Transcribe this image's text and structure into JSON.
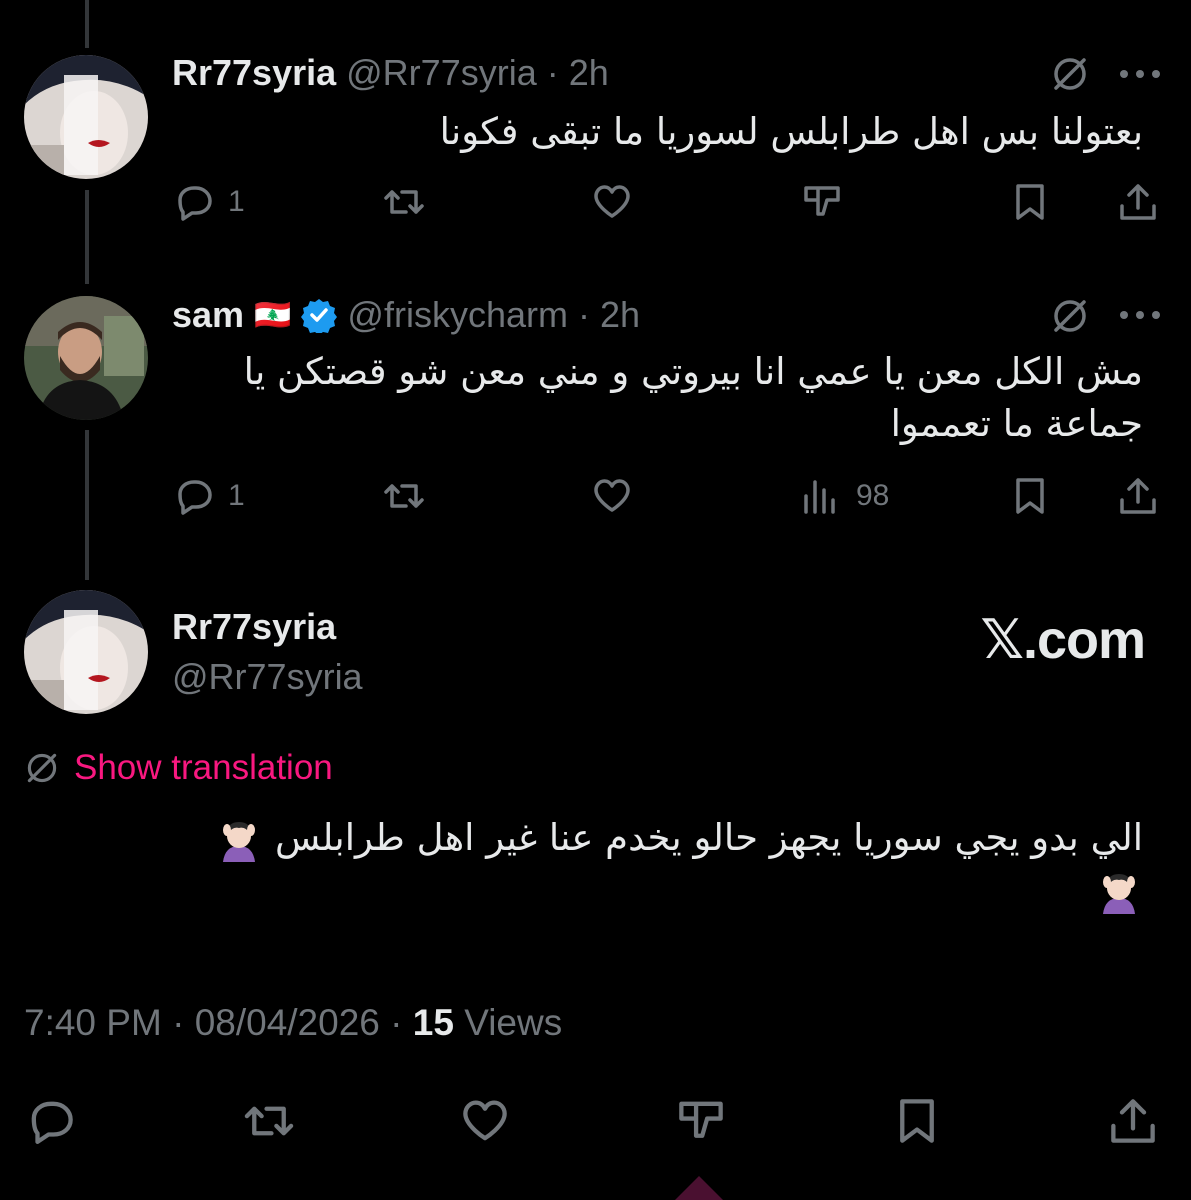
{
  "brand_label": "𝕏.com",
  "accent_color": "#f91880",
  "verified_color": "#1d9bf0",
  "tweets": [
    {
      "display_name": "Rr77syria",
      "handle": "@Rr77syria",
      "time": "2h",
      "text": "بعتولنا بس اهل طرابلس لسوريا ما تبقى فكونا",
      "reply_count": "1",
      "icons": [
        "reply-icon",
        "retweet-icon",
        "like-icon",
        "dislike-icon",
        "bookmark-icon",
        "share-icon"
      ]
    },
    {
      "display_name": "sam",
      "flag": "🇱🇧",
      "handle": "@friskycharm",
      "time": "2h",
      "text_line1": "مش الكل معن يا عمي انا بيروتي و مني معن شو قصتكن يا",
      "text_line2": "جماعة ما تعمموا",
      "reply_count": "1",
      "views_count": "98",
      "icons": [
        "reply-icon",
        "retweet-icon",
        "like-icon",
        "views-icon",
        "bookmark-icon",
        "share-icon"
      ]
    }
  ],
  "main_tweet": {
    "display_name": "Rr77syria",
    "handle": "@Rr77syria",
    "show_translation": "Show translation",
    "text": "الي بدو يجي سوريا يجهز حالو يخدم عنا غير اهل طرابلس",
    "time": "7:40 PM",
    "date": "08/04/2026",
    "views_count": "15",
    "views_label": "Views",
    "icons": [
      "reply-icon",
      "retweet-icon",
      "like-icon",
      "dislike-icon",
      "bookmark-icon",
      "share-icon"
    ]
  }
}
